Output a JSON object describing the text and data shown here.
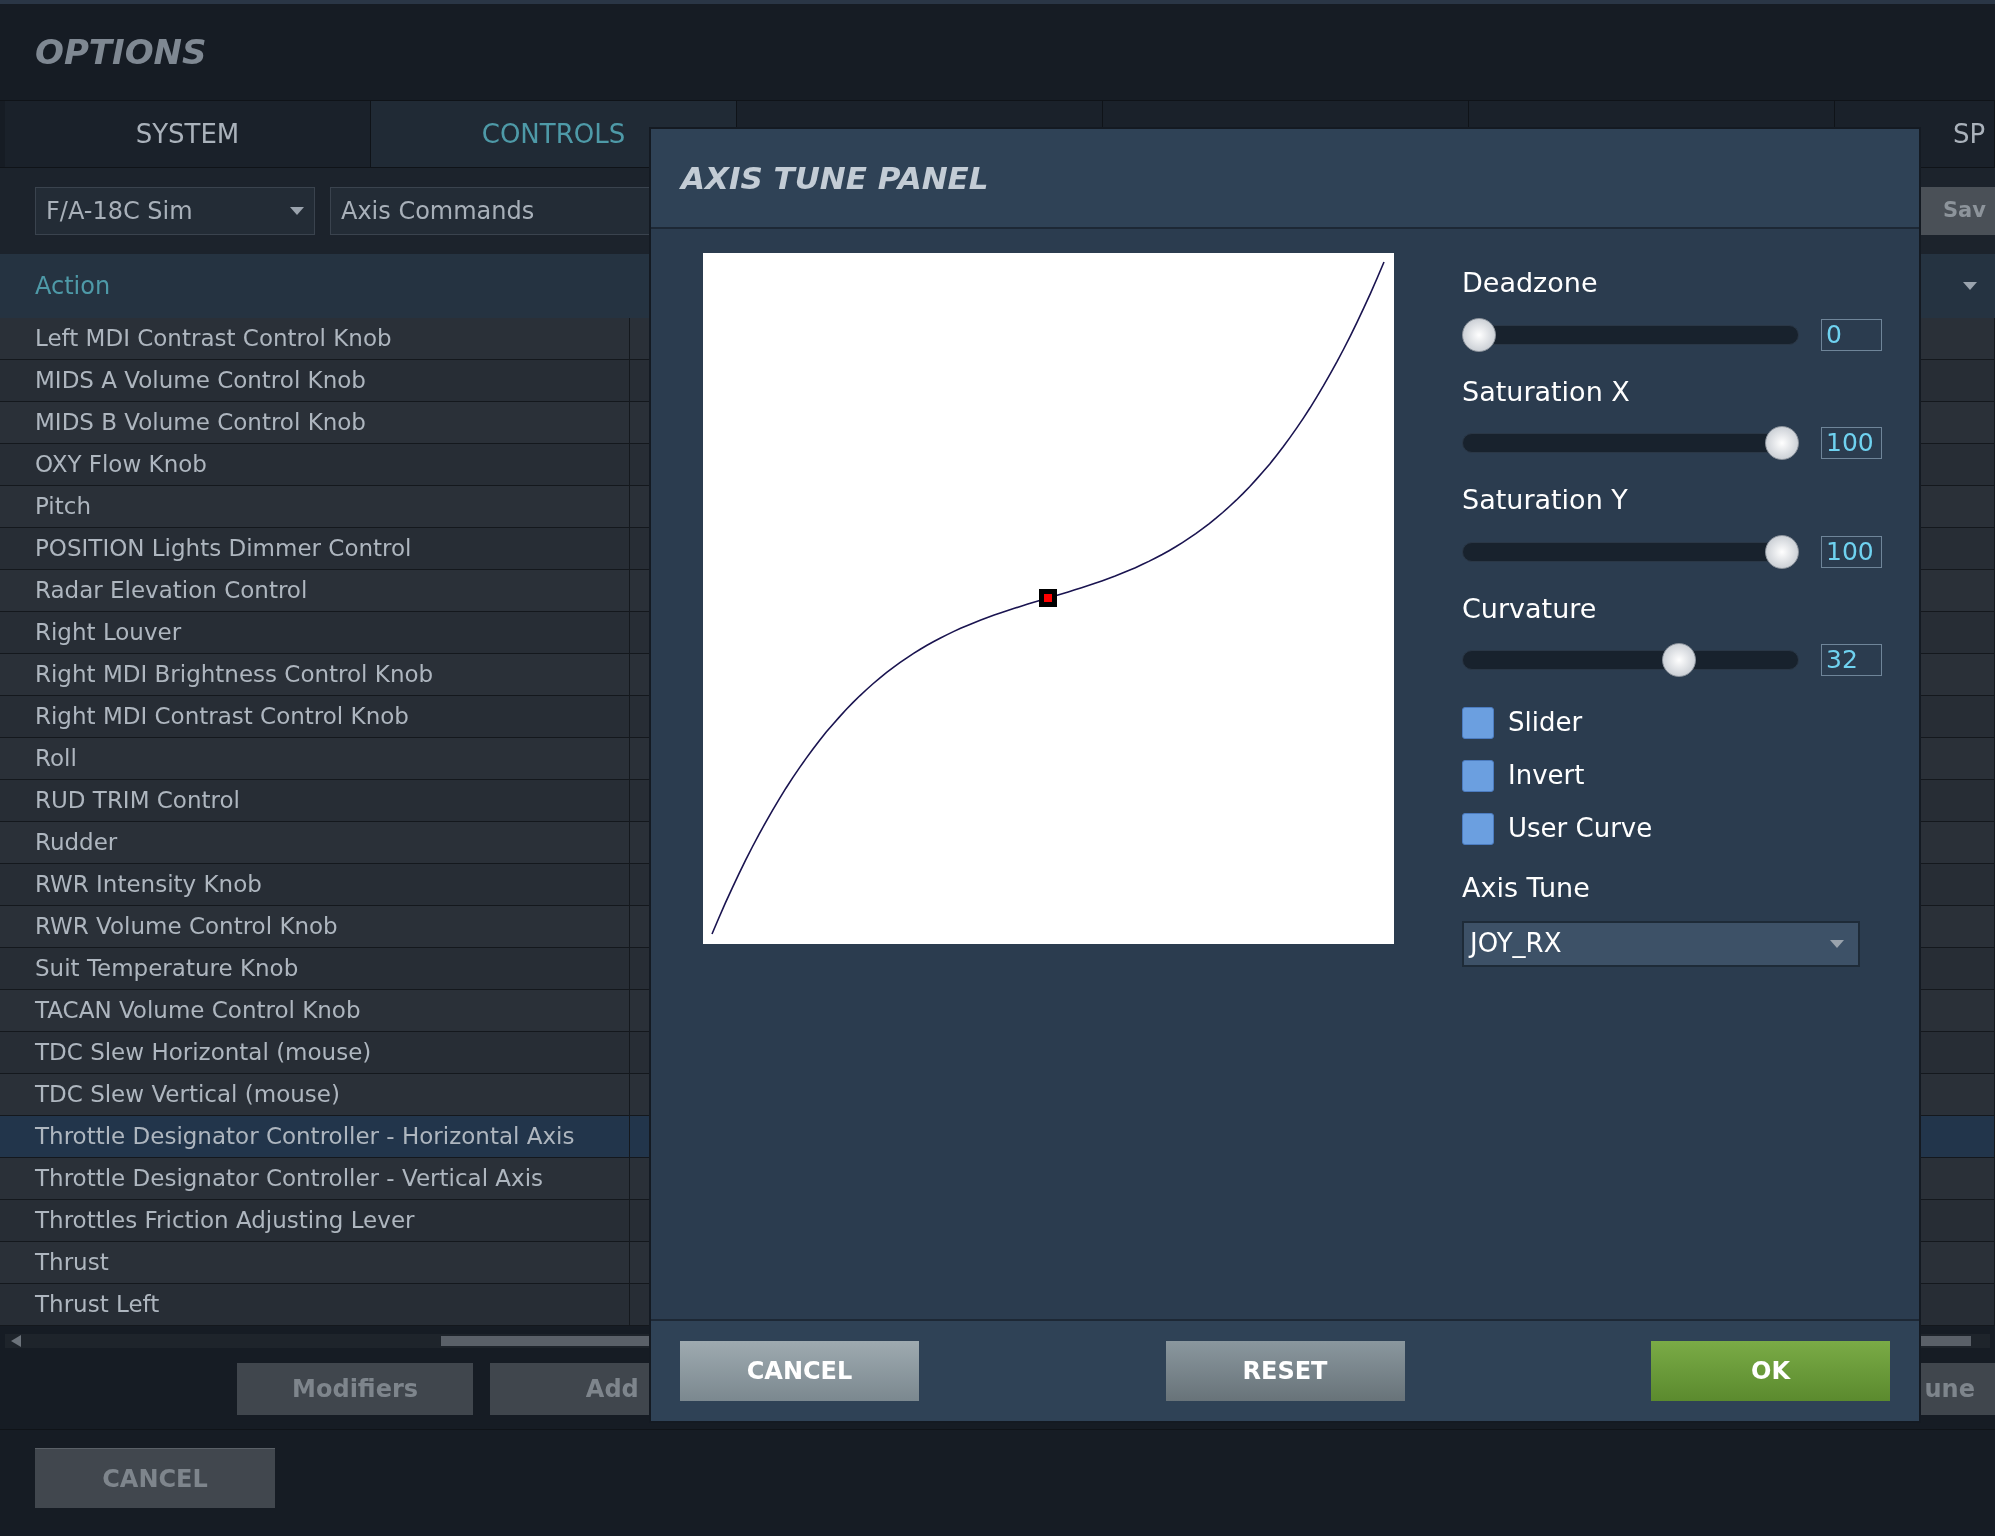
{
  "window": {
    "title": "OPTIONS"
  },
  "tabs": [
    {
      "label": "SYSTEM",
      "selected": false
    },
    {
      "label": "CONTROLS",
      "selected": true
    },
    {
      "label": "SP",
      "selected": false
    }
  ],
  "toolbar": {
    "aircraft": "F/A-18C Sim",
    "category": "Axis Commands",
    "save_button": "Sav"
  },
  "table": {
    "columns": [
      {
        "label": "Action"
      }
    ],
    "rows": [
      {
        "action": "Left MDI Contrast Control Knob",
        "selected": false
      },
      {
        "action": "MIDS A Volume Control Knob",
        "selected": false
      },
      {
        "action": "MIDS B Volume Control Knob",
        "selected": false
      },
      {
        "action": "OXY Flow Knob",
        "selected": false
      },
      {
        "action": "Pitch",
        "selected": false
      },
      {
        "action": "POSITION Lights Dimmer Control",
        "selected": false
      },
      {
        "action": "Radar Elevation Control",
        "selected": false
      },
      {
        "action": "Right Louver",
        "selected": false
      },
      {
        "action": "Right MDI Brightness Control Knob",
        "selected": false
      },
      {
        "action": "Right MDI Contrast Control Knob",
        "selected": false
      },
      {
        "action": "Roll",
        "selected": false
      },
      {
        "action": "RUD TRIM Control",
        "selected": false
      },
      {
        "action": "Rudder",
        "selected": false
      },
      {
        "action": "RWR Intensity Knob",
        "selected": false
      },
      {
        "action": "RWR Volume Control Knob",
        "selected": false
      },
      {
        "action": "Suit Temperature Knob",
        "selected": false
      },
      {
        "action": "TACAN Volume Control Knob",
        "selected": false
      },
      {
        "action": "TDC Slew Horizontal (mouse)",
        "selected": false
      },
      {
        "action": "TDC Slew Vertical (mouse)",
        "selected": false
      },
      {
        "action": "Throttle Designator Controller - Horizontal Axis",
        "selected": true
      },
      {
        "action": "Throttle Designator Controller - Vertical Axis",
        "selected": false
      },
      {
        "action": "Throttles Friction Adjusting Lever",
        "selected": false
      },
      {
        "action": "Thrust",
        "selected": false
      },
      {
        "action": "Thrust Left",
        "selected": false
      }
    ]
  },
  "bottom_buttons": [
    "Modifiers",
    "Add",
    "une"
  ],
  "footer": {
    "cancel_button": "CANCEL"
  },
  "axis_tune_panel": {
    "title": "AXIS TUNE PANEL",
    "sliders": [
      {
        "label": "Deadzone",
        "level": 0,
        "reading": "0"
      },
      {
        "label": "Saturation X",
        "level": 1,
        "reading": "100"
      },
      {
        "label": "Saturation Y",
        "level": 1,
        "reading": "100"
      },
      {
        "label": "Curvature",
        "level": 0.66,
        "reading": "32"
      }
    ],
    "checkboxes": [
      {
        "label": "Slider",
        "checked": false
      },
      {
        "label": "Invert",
        "checked": false
      },
      {
        "label": "User Curve",
        "checked": false
      }
    ],
    "axis_tune": {
      "label": "Axis Tune",
      "value": "JOY_RX"
    },
    "buttons": [
      {
        "label": "CANCEL",
        "kind": "secondary"
      },
      {
        "label": "RESET",
        "kind": "secondary"
      },
      {
        "label": "OK",
        "kind": "primary"
      }
    ]
  }
}
